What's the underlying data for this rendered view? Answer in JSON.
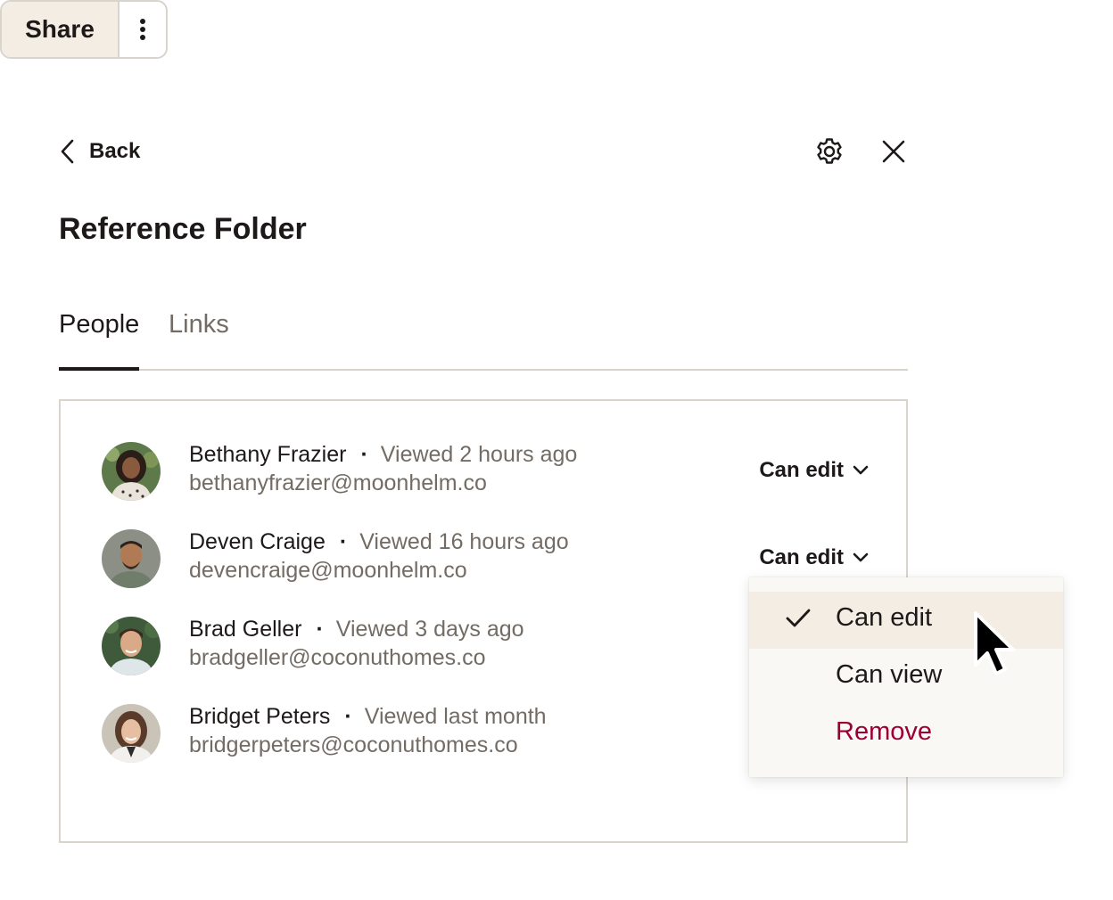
{
  "toolbar": {
    "share_label": "Share",
    "more_icon": "more-vertical-icon"
  },
  "header": {
    "back_label": "Back",
    "settings_icon": "gear-icon",
    "close_icon": "close-icon"
  },
  "folder": {
    "title": "Reference Folder"
  },
  "tabs": [
    {
      "label": "People",
      "active": true
    },
    {
      "label": "Links",
      "active": false
    }
  ],
  "people": [
    {
      "name": "Bethany Frazier",
      "separator": "·",
      "viewed": "Viewed 2 hours ago",
      "email": "bethanyfrazier@moonhelm.co",
      "permission": "Can edit"
    },
    {
      "name": "Deven Craige",
      "separator": "·",
      "viewed": "Viewed 16 hours ago",
      "email": "devencraige@moonhelm.co",
      "permission": "Can edit"
    },
    {
      "name": "Brad Geller",
      "separator": "·",
      "viewed": "Viewed 3 days ago",
      "email": "bradgeller@coconuthomes.co",
      "permission": ""
    },
    {
      "name": "Bridget Peters",
      "separator": "·",
      "viewed": "Viewed last month",
      "email": "bridgerpeters@coconuthomes.co",
      "permission": ""
    }
  ],
  "dropdown": {
    "options": [
      {
        "label": "Can edit",
        "selected": true
      },
      {
        "label": "Can view",
        "selected": false
      },
      {
        "label": "Remove",
        "destructive": true
      }
    ]
  },
  "colors": {
    "accent_bg": "#f3ede3",
    "border": "#d9d4cc",
    "muted_text": "#736c64",
    "destructive": "#9b0032",
    "text": "#1e1919"
  }
}
